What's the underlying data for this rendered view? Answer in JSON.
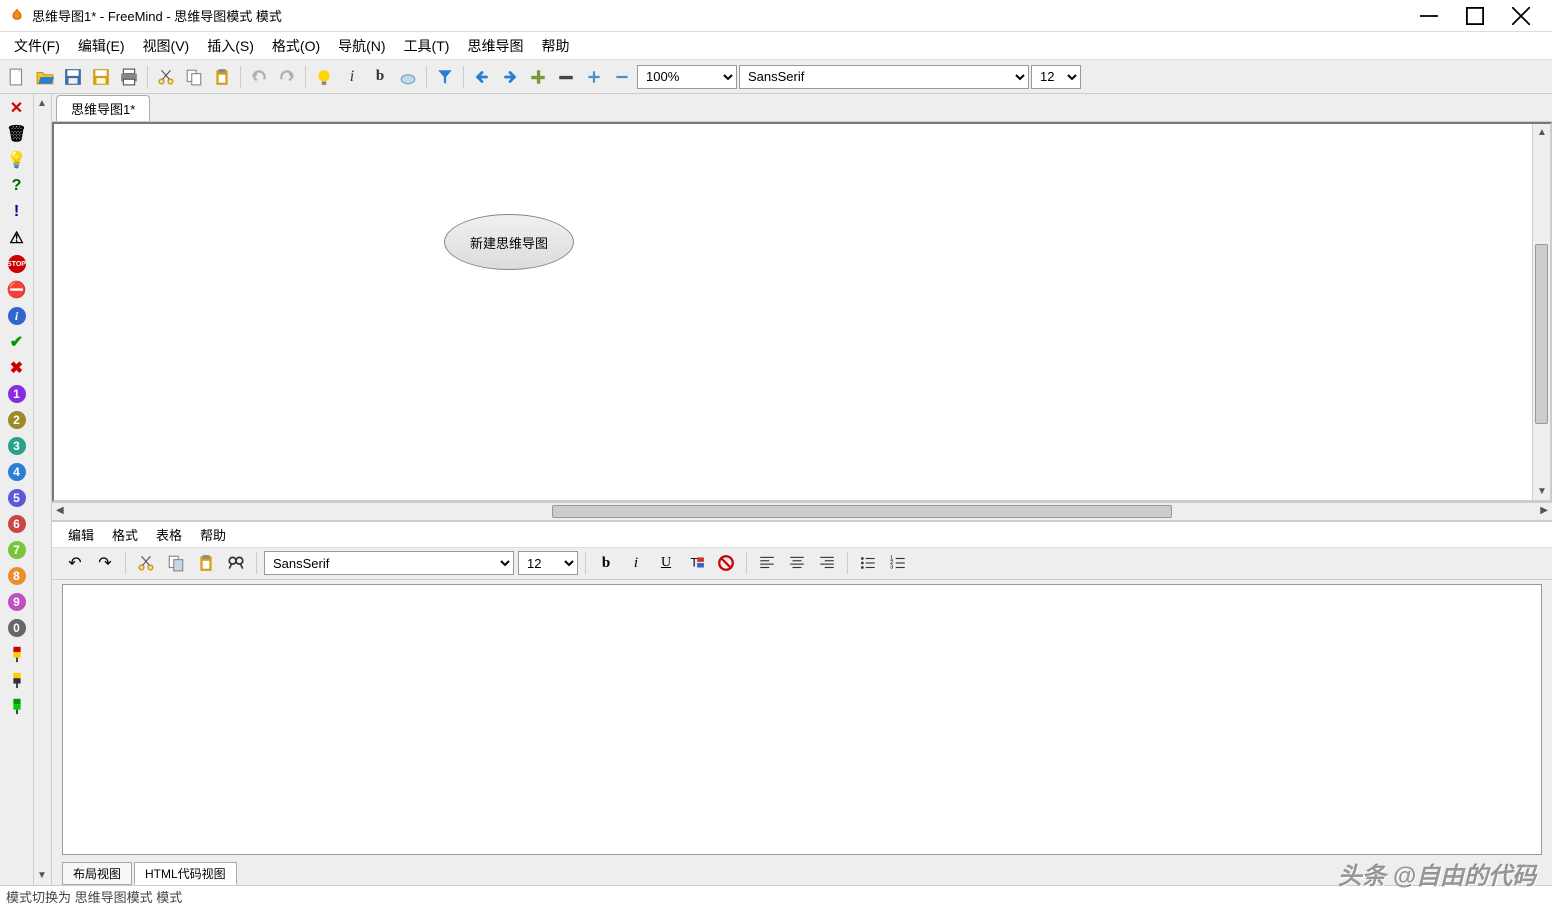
{
  "window": {
    "title": "思维导图1* - FreeMind - 思维导图模式 模式"
  },
  "menubar": {
    "file": "文件(F)",
    "edit": "编辑(E)",
    "view": "视图(V)",
    "insert": "插入(S)",
    "format": "格式(O)",
    "navigate": "导航(N)",
    "tools": "工具(T)",
    "mindmap": "思维导图",
    "help": "帮助"
  },
  "toolbar": {
    "zoom": "100%",
    "font": "SansSerif",
    "size": "12"
  },
  "tabs": {
    "doc1": "思维导图1*"
  },
  "rootNode": "新建思维导图",
  "editorMenu": {
    "edit": "编辑",
    "format": "格式",
    "table": "表格",
    "help": "帮助"
  },
  "editorToolbar": {
    "font": "SansSerif",
    "size": "12"
  },
  "editorTabs": {
    "layout": "布局视图",
    "html": "HTML代码视图"
  },
  "statusbar": "模式切换为 思维导图模式 模式",
  "watermark": "头条 @自由的代码"
}
